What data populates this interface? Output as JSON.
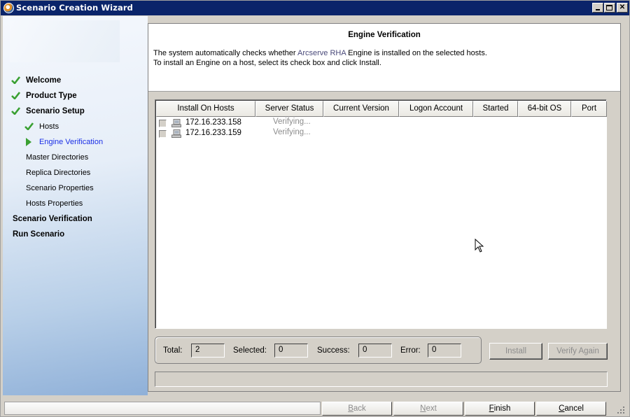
{
  "window": {
    "title": "Scenario Creation Wizard",
    "controls": [
      "minimize",
      "maximize",
      "close"
    ]
  },
  "sidebar": {
    "items": [
      {
        "label": "Welcome",
        "state": "done",
        "level": 0
      },
      {
        "label": "Product Type",
        "state": "done",
        "level": 0
      },
      {
        "label": "Scenario Setup",
        "state": "done",
        "level": 0
      },
      {
        "label": "Hosts",
        "state": "done",
        "level": 1
      },
      {
        "label": "Engine Verification",
        "state": "current",
        "level": 1
      },
      {
        "label": "Master Directories",
        "state": "pending",
        "level": 1
      },
      {
        "label": "Replica Directories",
        "state": "pending",
        "level": 1
      },
      {
        "label": "Scenario Properties",
        "state": "pending",
        "level": 1
      },
      {
        "label": "Hosts Properties",
        "state": "pending",
        "level": 1
      },
      {
        "label": "Scenario Verification",
        "state": "pending",
        "level": 0
      },
      {
        "label": "Run Scenario",
        "state": "pending",
        "level": 0
      }
    ]
  },
  "header": {
    "title": "Engine Verification",
    "desc1_pre": "The system automatically checks whether ",
    "desc1_brand": "Arcserve RHA",
    "desc1_post": " Engine is installed on the selected hosts.",
    "desc2": "To install an Engine on a host, select its check box and click Install."
  },
  "grid": {
    "columns": [
      "Install On Hosts",
      "Server Status",
      "Current Version",
      "Logon Account",
      "Started",
      "64-bit OS",
      "Port"
    ],
    "rows": [
      {
        "checked": false,
        "icon": "computer-icon",
        "host": "172.16.233.158",
        "status": "Verifying..."
      },
      {
        "checked": false,
        "icon": "computer-icon",
        "host": "172.16.233.159",
        "status": "Verifying..."
      }
    ]
  },
  "summary": {
    "total_label": "Total:",
    "total": "2",
    "selected_label": "Selected:",
    "selected": "0",
    "success_label": "Success:",
    "success": "0",
    "error_label": "Error:",
    "error": "0"
  },
  "actions": {
    "install": "Install",
    "verify_again": "Verify Again"
  },
  "footer": {
    "back_accel": "B",
    "back_rest": "ack",
    "next_accel": "N",
    "next_rest": "ext",
    "finish_accel": "F",
    "finish_rest": "inish",
    "cancel_accel": "C",
    "cancel_rest": "ancel"
  },
  "colors": {
    "titlebar": "#0a246a",
    "current_step": "#1a2ee6",
    "check_green": "#3aa032",
    "disabled_text": "#8c8c8c"
  }
}
